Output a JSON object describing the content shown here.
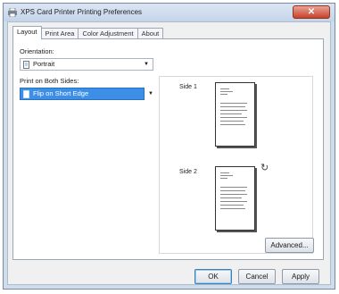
{
  "window": {
    "title": "XPS Card Printer Printing Preferences",
    "close_glyph": "✕"
  },
  "tabs": [
    {
      "label": "Layout",
      "active": true
    },
    {
      "label": "Print Area",
      "active": false
    },
    {
      "label": "Color Adjustment",
      "active": false
    },
    {
      "label": "About",
      "active": false
    }
  ],
  "layout": {
    "orientation_label": "Orientation:",
    "orientation_value": "Portrait",
    "both_sides_label": "Print on Both Sides:",
    "both_sides_value": "Flip on Short Edge",
    "dropdown_glyph": "▼"
  },
  "preview": {
    "side1_label": "Side 1",
    "side2_label": "Side 2",
    "rotate_glyph": "↻"
  },
  "buttons": {
    "advanced": "Advanced...",
    "ok": "OK",
    "cancel": "Cancel",
    "apply": "Apply"
  },
  "icons": {
    "window_icon": "printer-icon",
    "orientation_icon": "portrait-page-icon",
    "duplex_icon": "flip-short-edge-icon"
  },
  "colors": {
    "selection": "#3d8ee6",
    "titlebar": "#c4d4e8",
    "close_button": "#c8412a"
  }
}
